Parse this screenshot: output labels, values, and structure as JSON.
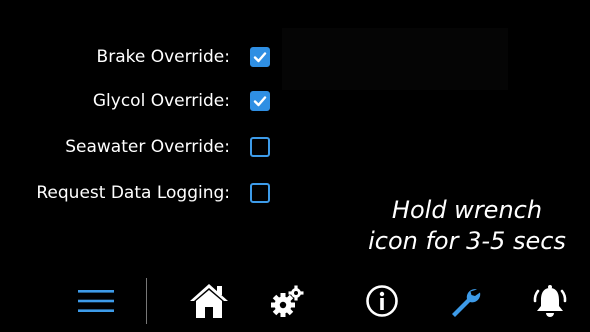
{
  "overrides": [
    {
      "label": "Brake Override:",
      "checked": true
    },
    {
      "label": "Glycol Override:",
      "checked": true
    },
    {
      "label": "Seawater Override:",
      "checked": false
    },
    {
      "label": "Request Data Logging:",
      "checked": false
    }
  ],
  "hint": {
    "line1": "Hold wrench",
    "line2": "icon for 3-5 secs"
  },
  "toolbar": {
    "items": [
      {
        "icon": "menu-icon",
        "color": "#3d9be9"
      },
      {
        "icon": "home-icon",
        "color": "#ffffff"
      },
      {
        "icon": "gears-icon",
        "color": "#ffffff"
      },
      {
        "icon": "info-icon",
        "color": "#ffffff"
      },
      {
        "icon": "wrench-icon",
        "color": "#3d9be9"
      },
      {
        "icon": "alarm-bell-icon",
        "color": "#ffffff"
      }
    ]
  },
  "colors": {
    "accent": "#3d9be9",
    "checked_fill": "#2f8fe3",
    "background": "#000000",
    "text": "#ffffff"
  }
}
